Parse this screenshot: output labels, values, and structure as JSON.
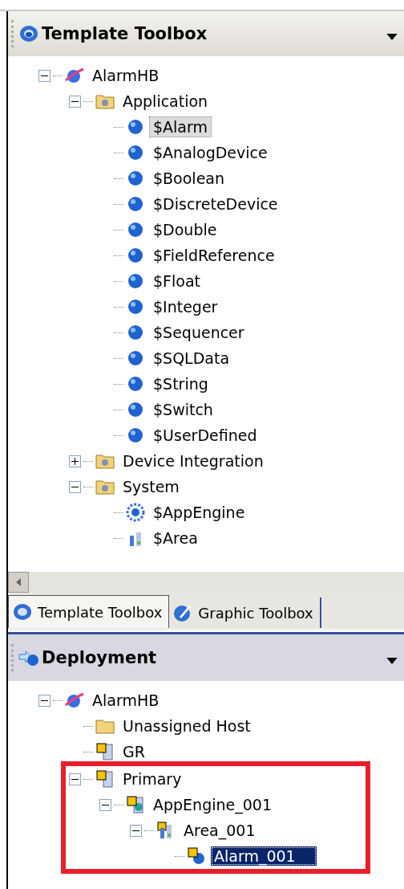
{
  "template_toolbox": {
    "title": "Template Toolbox",
    "focused": false,
    "tree": [
      {
        "label": "AlarmHB",
        "kind": "galaxy",
        "expanded": true,
        "selected": false,
        "children": [
          {
            "label": "Application",
            "kind": "toolset",
            "expanded": true,
            "selected": false,
            "children": [
              {
                "label": "$Alarm",
                "kind": "sphere",
                "selected": true
              },
              {
                "label": "$AnalogDevice",
                "kind": "sphere",
                "selected": false
              },
              {
                "label": "$Boolean",
                "kind": "sphere",
                "selected": false
              },
              {
                "label": "$DiscreteDevice",
                "kind": "sphere",
                "selected": false
              },
              {
                "label": "$Double",
                "kind": "sphere",
                "selected": false
              },
              {
                "label": "$FieldReference",
                "kind": "sphere",
                "selected": false
              },
              {
                "label": "$Float",
                "kind": "sphere",
                "selected": false
              },
              {
                "label": "$Integer",
                "kind": "sphere",
                "selected": false
              },
              {
                "label": "$Sequencer",
                "kind": "sphere",
                "selected": false
              },
              {
                "label": "$SQLData",
                "kind": "sphere",
                "selected": false
              },
              {
                "label": "$String",
                "kind": "sphere",
                "selected": false
              },
              {
                "label": "$Switch",
                "kind": "sphere",
                "selected": false
              },
              {
                "label": "$UserDefined",
                "kind": "sphere",
                "selected": false
              }
            ]
          },
          {
            "label": "Device Integration",
            "kind": "toolset",
            "expanded": false,
            "selected": false
          },
          {
            "label": "System",
            "kind": "toolset",
            "expanded": true,
            "selected": false,
            "children": [
              {
                "label": "$AppEngine",
                "kind": "gear",
                "selected": false
              },
              {
                "label": "$Area",
                "kind": "area",
                "selected": false
              }
            ]
          }
        ]
      }
    ]
  },
  "tabs": [
    {
      "label": "Template Toolbox",
      "kind": "template",
      "selected": true
    },
    {
      "label": "Graphic Toolbox",
      "kind": "graphic",
      "selected": false
    }
  ],
  "deployment": {
    "title": "Deployment",
    "focused": true,
    "tree": [
      {
        "label": "AlarmHB",
        "kind": "galaxy",
        "expanded": true,
        "selected": false,
        "children": [
          {
            "label": "Unassigned Host",
            "kind": "folder",
            "selected": false
          },
          {
            "label": "GR",
            "kind": "platform",
            "selected": false
          },
          {
            "label": "Primary",
            "kind": "platform",
            "expanded": true,
            "selected": false,
            "highlighted": true,
            "children": [
              {
                "label": "AppEngine_001",
                "kind": "engine",
                "expanded": true,
                "selected": false,
                "children": [
                  {
                    "label": "Area_001",
                    "kind": "area-instance",
                    "expanded": true,
                    "selected": false,
                    "children": [
                      {
                        "label": "Alarm_001",
                        "kind": "object",
                        "selected": true
                      }
                    ]
                  }
                ]
              }
            ]
          }
        ]
      }
    ]
  }
}
